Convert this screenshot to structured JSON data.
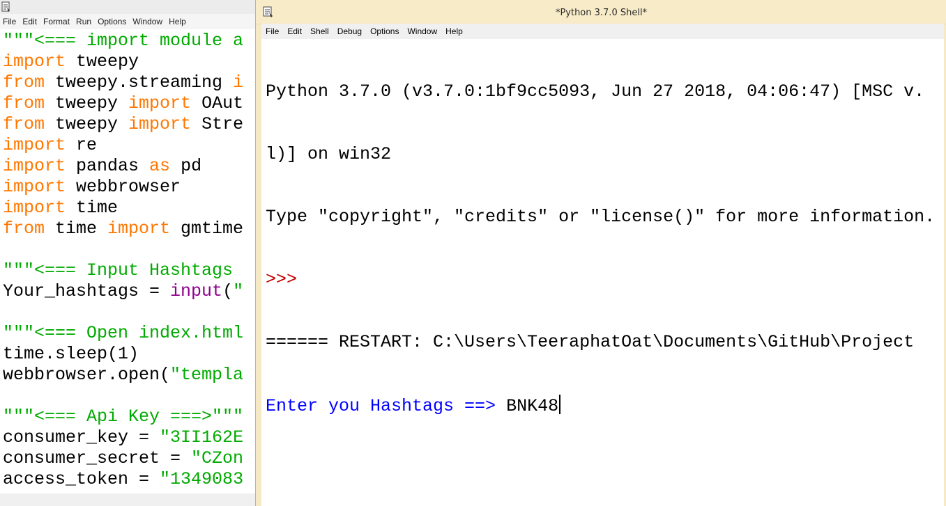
{
  "editor": {
    "menu": [
      "File",
      "Edit",
      "Format",
      "Run",
      "Options",
      "Window",
      "Help"
    ],
    "lines": [
      [
        {
          "t": "s",
          "v": "\"\"\"<=== import module a"
        }
      ],
      [
        {
          "t": "k",
          "v": "import"
        },
        {
          "t": "n",
          "v": " tweepy"
        }
      ],
      [
        {
          "t": "k",
          "v": "from"
        },
        {
          "t": "n",
          "v": " tweepy.streaming "
        },
        {
          "t": "k",
          "v": "i"
        }
      ],
      [
        {
          "t": "k",
          "v": "from"
        },
        {
          "t": "n",
          "v": " tweepy "
        },
        {
          "t": "k",
          "v": "import"
        },
        {
          "t": "n",
          "v": " OAut"
        }
      ],
      [
        {
          "t": "k",
          "v": "from"
        },
        {
          "t": "n",
          "v": " tweepy "
        },
        {
          "t": "k",
          "v": "import"
        },
        {
          "t": "n",
          "v": " Stre"
        }
      ],
      [
        {
          "t": "k",
          "v": "import"
        },
        {
          "t": "n",
          "v": " re"
        }
      ],
      [
        {
          "t": "k",
          "v": "import"
        },
        {
          "t": "n",
          "v": " pandas "
        },
        {
          "t": "k",
          "v": "as"
        },
        {
          "t": "n",
          "v": " pd"
        }
      ],
      [
        {
          "t": "k",
          "v": "import"
        },
        {
          "t": "n",
          "v": " webbrowser"
        }
      ],
      [
        {
          "t": "k",
          "v": "import"
        },
        {
          "t": "n",
          "v": " time"
        }
      ],
      [
        {
          "t": "k",
          "v": "from"
        },
        {
          "t": "n",
          "v": " time "
        },
        {
          "t": "k",
          "v": "import"
        },
        {
          "t": "n",
          "v": " gmtime"
        }
      ],
      [],
      [
        {
          "t": "s",
          "v": "\"\"\"<=== Input Hashtags "
        }
      ],
      [
        {
          "t": "n",
          "v": "Your_hashtags = "
        },
        {
          "t": "b",
          "v": "input"
        },
        {
          "t": "n",
          "v": "("
        },
        {
          "t": "s",
          "v": "\""
        }
      ],
      [],
      [
        {
          "t": "s",
          "v": "\"\"\"<=== Open index.html"
        }
      ],
      [
        {
          "t": "n",
          "v": "time.sleep(1)"
        }
      ],
      [
        {
          "t": "n",
          "v": "webbrowser.open("
        },
        {
          "t": "s",
          "v": "\"templa"
        }
      ],
      [],
      [
        {
          "t": "s",
          "v": "\"\"\"<=== Api Key ===>\"\"\""
        }
      ],
      [
        {
          "t": "n",
          "v": "consumer_key = "
        },
        {
          "t": "s",
          "v": "\"3II162E"
        }
      ],
      [
        {
          "t": "n",
          "v": "consumer_secret = "
        },
        {
          "t": "s",
          "v": "\"CZon"
        }
      ],
      [
        {
          "t": "n",
          "v": "access_token = "
        },
        {
          "t": "s",
          "v": "\"1349083"
        }
      ]
    ]
  },
  "shell": {
    "title": "*Python 3.7.0 Shell*",
    "menu": [
      "File",
      "Edit",
      "Shell",
      "Debug",
      "Options",
      "Window",
      "Help"
    ],
    "banner_line1": "Python 3.7.0 (v3.7.0:1bf9cc5093, Jun 27 2018, 04:06:47) [MSC v.",
    "banner_line2": "l)] on win32",
    "banner_line3": "Type \"copyright\", \"credits\" or \"license()\" for more information.",
    "prompt": ">>> ",
    "restart_line": "====== RESTART: C:\\Users\\TeeraphatOat\\Documents\\GitHub\\Project",
    "input_prompt": "Enter you Hashtags ==> ",
    "input_value": "BNK48"
  },
  "colors": {
    "keyword": "#ff7700",
    "string": "#00aa00",
    "builtin": "#900090",
    "prompt": "#c00000",
    "stdout": "#0000ff",
    "shell_frame": "#f7ebc8"
  },
  "icons": {
    "editor_app": "python-idle-icon",
    "shell_app": "python-idle-icon"
  }
}
